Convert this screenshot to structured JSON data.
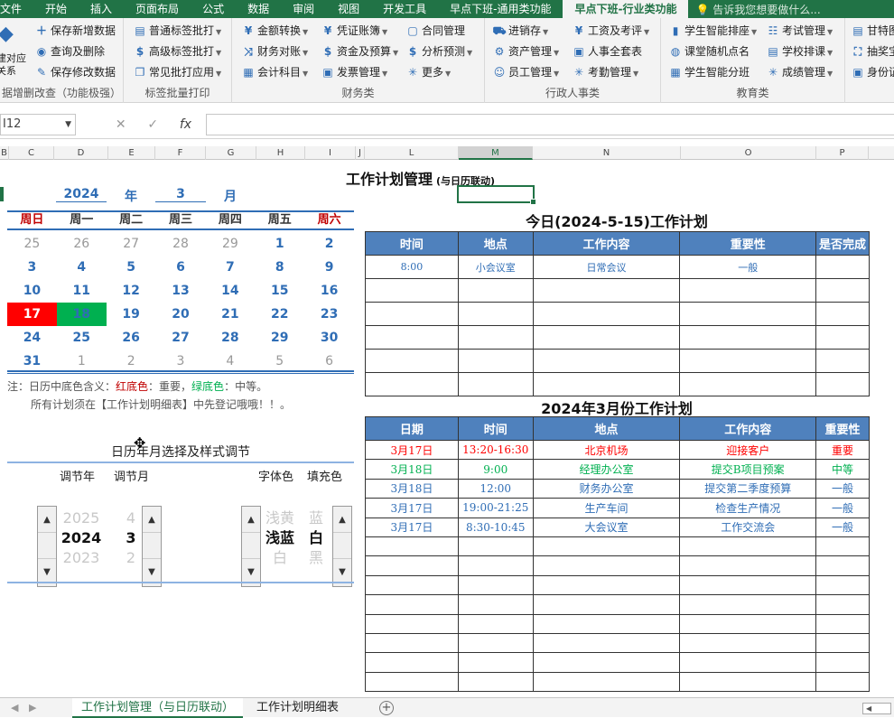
{
  "menu": {
    "tabs": [
      "文件",
      "开始",
      "插入",
      "页面布局",
      "公式",
      "数据",
      "审阅",
      "视图",
      "开发工具",
      "早点下班-通用类功能",
      "早点下班-行业类功能"
    ],
    "active_index": 10,
    "tell_me": "告诉我您想要做什么..."
  },
  "ribbon": {
    "group1": {
      "big_label_1": "建对应",
      "big_label_2": "关系",
      "items": [
        "保存新增数据",
        "查询及删除",
        "保存修改数据"
      ],
      "label": "据增删改查（功能极强）"
    },
    "group2": {
      "items": [
        "普通标签批打",
        "高级标签批打",
        "常见批打应用"
      ],
      "label": "标签批量打印"
    },
    "group3": {
      "items": [
        "金额转换",
        "财务对账",
        "会计科目",
        "凭证账簿",
        "资金及预算",
        "发票管理",
        "合同管理",
        "分析预测",
        "更多"
      ],
      "label": "财务类"
    },
    "group4": {
      "items": [
        "进销存",
        "资产管理",
        "员工管理",
        "工资及考评",
        "人事全套表",
        "考勤管理"
      ],
      "label": "行政人事类"
    },
    "group5": {
      "items": [
        "学生智能排座",
        "课堂随机点名",
        "学生智能分班",
        "考试管理",
        "学校排课",
        "成绩管理"
      ],
      "label": "教育类"
    },
    "group6": {
      "items": [
        "甘特图",
        "抽奖宝",
        "身份证"
      ]
    }
  },
  "formula_bar": {
    "name_box": "I12",
    "fx": "fx",
    "value": ""
  },
  "columns": [
    "B",
    "C",
    "D",
    "E",
    "F",
    "G",
    "H",
    "I",
    "J",
    "L",
    "M",
    "N",
    "O",
    "P"
  ],
  "selected_column": "M",
  "sheet": {
    "title": "工作计划管理",
    "title_sub": "(与日历联动)",
    "year": "2024",
    "year_unit": "年",
    "month": "3",
    "month_unit": "月",
    "weekdays": [
      "周日",
      "周一",
      "周二",
      "周三",
      "周四",
      "周五",
      "周六"
    ],
    "calendar": [
      [
        {
          "d": "25",
          "t": "grey"
        },
        {
          "d": "26",
          "t": "grey"
        },
        {
          "d": "27",
          "t": "grey"
        },
        {
          "d": "28",
          "t": "grey"
        },
        {
          "d": "29",
          "t": "grey"
        },
        {
          "d": "1",
          "t": ""
        },
        {
          "d": "2",
          "t": ""
        }
      ],
      [
        {
          "d": "3",
          "t": ""
        },
        {
          "d": "4",
          "t": ""
        },
        {
          "d": "5",
          "t": ""
        },
        {
          "d": "6",
          "t": ""
        },
        {
          "d": "7",
          "t": ""
        },
        {
          "d": "8",
          "t": ""
        },
        {
          "d": "9",
          "t": ""
        }
      ],
      [
        {
          "d": "10",
          "t": ""
        },
        {
          "d": "11",
          "t": ""
        },
        {
          "d": "12",
          "t": ""
        },
        {
          "d": "13",
          "t": ""
        },
        {
          "d": "14",
          "t": ""
        },
        {
          "d": "15",
          "t": ""
        },
        {
          "d": "16",
          "t": ""
        }
      ],
      [
        {
          "d": "17",
          "t": "red"
        },
        {
          "d": "18",
          "t": "green"
        },
        {
          "d": "19",
          "t": ""
        },
        {
          "d": "20",
          "t": ""
        },
        {
          "d": "21",
          "t": ""
        },
        {
          "d": "22",
          "t": ""
        },
        {
          "d": "23",
          "t": ""
        }
      ],
      [
        {
          "d": "24",
          "t": ""
        },
        {
          "d": "25",
          "t": ""
        },
        {
          "d": "26",
          "t": ""
        },
        {
          "d": "27",
          "t": ""
        },
        {
          "d": "28",
          "t": ""
        },
        {
          "d": "29",
          "t": ""
        },
        {
          "d": "30",
          "t": ""
        }
      ],
      [
        {
          "d": "31",
          "t": ""
        },
        {
          "d": "1",
          "t": "grey"
        },
        {
          "d": "2",
          "t": "grey"
        },
        {
          "d": "3",
          "t": "grey"
        },
        {
          "d": "4",
          "t": "grey"
        },
        {
          "d": "5",
          "t": "grey"
        },
        {
          "d": "6",
          "t": "grey"
        }
      ]
    ],
    "note_prefix": "注：日历中底色含义：",
    "note_red": "红底色",
    "note_mid1": "：重要，",
    "note_green": "绿底色",
    "note_mid2": "：中等。",
    "note_line2": "所有计划须在【工作计划明细表】中先登记哦哦！！。",
    "adjust_title": "日历年月选择及样式调节",
    "adjust_labels": {
      "year": "调节年",
      "month": "调节月",
      "font_color": "字体色",
      "fill_color": "填充色"
    },
    "year_spin": {
      "prev": "2025",
      "cur": "2024",
      "next": "2023"
    },
    "month_spin": {
      "prev": "4",
      "cur": "3",
      "next": "2"
    },
    "font_spin": {
      "prev": "浅黄",
      "cur": "浅蓝",
      "next": "白"
    },
    "fill_spin": {
      "prev": "蓝",
      "cur": "白",
      "next": "黑"
    }
  },
  "today_plan": {
    "title": "今日(2024-5-15)工作计划",
    "headers": [
      "时间",
      "地点",
      "工作内容",
      "重要性",
      "是否完成"
    ],
    "rows": [
      [
        "8:00",
        "小会议室",
        "日常会议",
        "一般",
        ""
      ],
      [
        "",
        "",
        "",
        "",
        ""
      ],
      [
        "",
        "",
        "",
        "",
        ""
      ],
      [
        "",
        "",
        "",
        "",
        ""
      ],
      [
        "",
        "",
        "",
        "",
        ""
      ],
      [
        "",
        "",
        "",
        "",
        ""
      ]
    ]
  },
  "month_plan": {
    "title": "2024年3月份工作计划",
    "headers": [
      "日期",
      "时间",
      "地点",
      "工作内容",
      "重要性"
    ],
    "rows": [
      {
        "c": "red",
        "v": [
          "3月17日",
          "13:20-16:30",
          "北京机场",
          "迎接客户",
          "重要"
        ]
      },
      {
        "c": "green",
        "v": [
          "3月18日",
          "9:00",
          "经理办公室",
          "提交B项目预案",
          "中等"
        ]
      },
      {
        "c": "blue",
        "v": [
          "3月18日",
          "12:00",
          "财务办公室",
          "提交第二季度预算",
          "一般"
        ]
      },
      {
        "c": "blue",
        "v": [
          "3月17日",
          "19:00-21:25",
          "生产车间",
          "检查生产情况",
          "一般"
        ]
      },
      {
        "c": "blue",
        "v": [
          "3月17日",
          "8:30-10:45",
          "大会议室",
          "工作交流会",
          "一般"
        ]
      },
      {
        "c": "",
        "v": [
          "",
          "",
          "",
          "",
          ""
        ]
      },
      {
        "c": "",
        "v": [
          "",
          "",
          "",
          "",
          ""
        ]
      },
      {
        "c": "",
        "v": [
          "",
          "",
          "",
          "",
          ""
        ]
      },
      {
        "c": "",
        "v": [
          "",
          "",
          "",
          "",
          ""
        ]
      },
      {
        "c": "",
        "v": [
          "",
          "",
          "",
          "",
          ""
        ]
      },
      {
        "c": "",
        "v": [
          "",
          "",
          "",
          "",
          ""
        ]
      },
      {
        "c": "",
        "v": [
          "",
          "",
          "",
          "",
          ""
        ]
      },
      {
        "c": "",
        "v": [
          "",
          "",
          "",
          "",
          ""
        ]
      }
    ]
  },
  "sheet_tabs": [
    "工作计划管理（与日历联动）",
    "工作计划明细表"
  ],
  "active_sheet": 0
}
